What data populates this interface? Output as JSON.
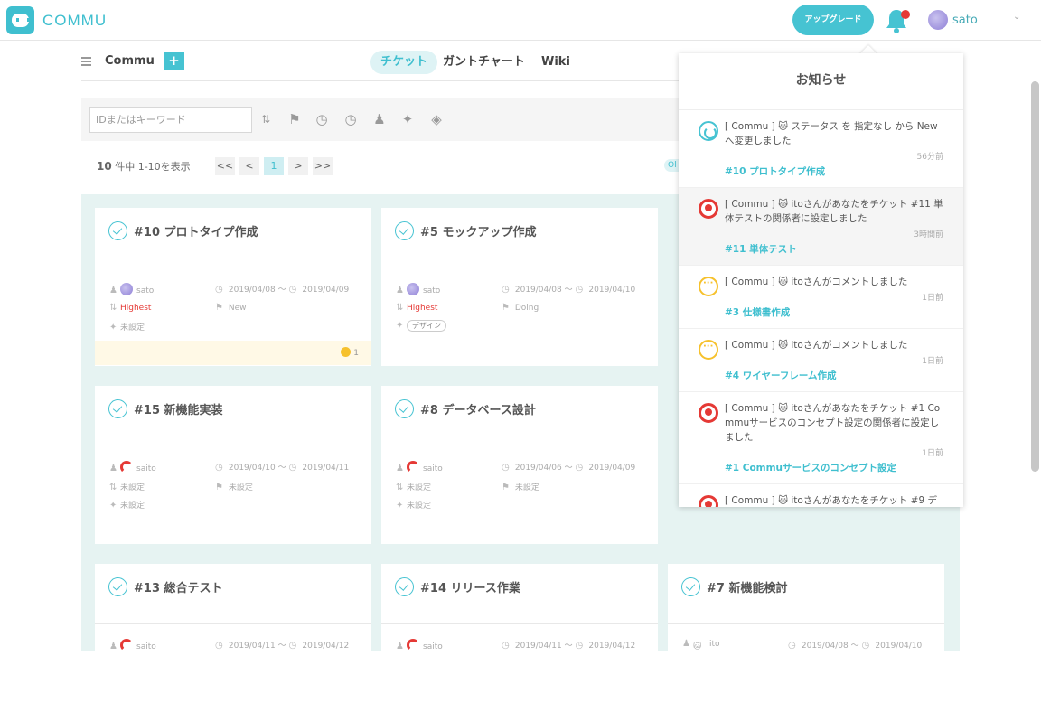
{
  "app": {
    "name": "COMMU",
    "upgrade_label": "アップグレード",
    "user_name": "sato"
  },
  "subbar": {
    "project_name": "Commu",
    "add_label": "+",
    "tabs": [
      {
        "label": "チケット",
        "active": true
      },
      {
        "label": "ガントチャート",
        "active": false
      },
      {
        "label": "Wiki",
        "active": false
      }
    ]
  },
  "filter": {
    "search_placeholder": "IDまたはキーワード",
    "icons": [
      "sort-icon",
      "flag-icon",
      "start-date-icon",
      "due-date-icon",
      "assignee-icon",
      "tag-icon",
      "status-icon"
    ]
  },
  "list": {
    "count_number": "10",
    "count_text": " 件中 1-10を表示",
    "pagination": [
      "<<",
      "<",
      "1",
      ">",
      ">>"
    ],
    "current_page": "1",
    "view_pill": "Ol"
  },
  "cards": [
    {
      "title": "#10 プロトタイプ作成",
      "assignee": "sato",
      "start": "2019/04/08",
      "end": "2019/04/09",
      "priority": "Highest",
      "status": "New",
      "tag": "未設定",
      "comments": "1"
    },
    {
      "title": "#5 モックアップ作成",
      "assignee": "sato",
      "start": "2019/04/08",
      "end": "2019/04/10",
      "priority": "Highest",
      "status": "Doing",
      "tag": "デザイン"
    },
    {
      "title": "#15 新機能実装",
      "assignee": "saito",
      "start": "2019/04/10",
      "end": "2019/04/11",
      "priority": "未設定",
      "status": "未設定",
      "tag": "未設定"
    },
    {
      "title": "#8 データベース設計",
      "assignee": "saito",
      "start": "2019/04/06",
      "end": "2019/04/09",
      "priority": "未設定",
      "status": "未設定",
      "tag": "未設定"
    },
    {
      "title": "#13 総合テスト",
      "assignee": "saito",
      "start": "2019/04/11",
      "end": "2019/04/12"
    },
    {
      "title": "#14 リリース作業",
      "assignee": "saito",
      "start": "2019/04/11",
      "end": "2019/04/12"
    },
    {
      "title": "#7 新機能検討",
      "assignee": "ito",
      "start": "2019/04/08",
      "end": "2019/04/10"
    }
  ],
  "date_sep": "〜",
  "notifications": {
    "title": "お知らせ",
    "items": [
      {
        "icon": "sync",
        "text1": "[ Commu ] 🐱 ステータス を 指定なし から New",
        "text2": "へ変更しました",
        "time": "56分前",
        "link": "#10 プロトタイプ作成",
        "shaded": false
      },
      {
        "icon": "user",
        "text1": "[ Commu ] 🐱 itoさんがあなたをチケット #11 単",
        "text2": "体テストの関係者に設定しました",
        "time": "3時間前",
        "link": "#11 単体テスト",
        "shaded": true
      },
      {
        "icon": "comment",
        "text1": "[ Commu ] 🐱 itoさんがコメントしました",
        "text2": "",
        "time": "1日前",
        "link": "#3 仕様書作成",
        "shaded": false
      },
      {
        "icon": "comment",
        "text1": "[ Commu ] 🐱 itoさんがコメントしました",
        "text2": "",
        "time": "1日前",
        "link": "#4 ワイヤーフレーム作成",
        "shaded": false
      },
      {
        "icon": "user",
        "text1": "[ Commu ] 🐱 itoさんがあなたをチケット #1 Co",
        "text2": "mmuサービスのコンセプト設定の関係者に設定し",
        "text3": "ました",
        "time": "1日前",
        "link": "#1 Commuサービスのコンセプト設定",
        "shaded": false
      },
      {
        "icon": "user",
        "text1": "[ Commu ] 🐱 itoさんがあなたをチケット #9 デ",
        "text2": "",
        "time": "",
        "link": "",
        "shaded": false
      }
    ]
  },
  "colors": {
    "accent": "#3fbfcf",
    "board_bg": "#e6f3f2",
    "priority_high": "#e53935",
    "notice_dot": "#e53935"
  }
}
